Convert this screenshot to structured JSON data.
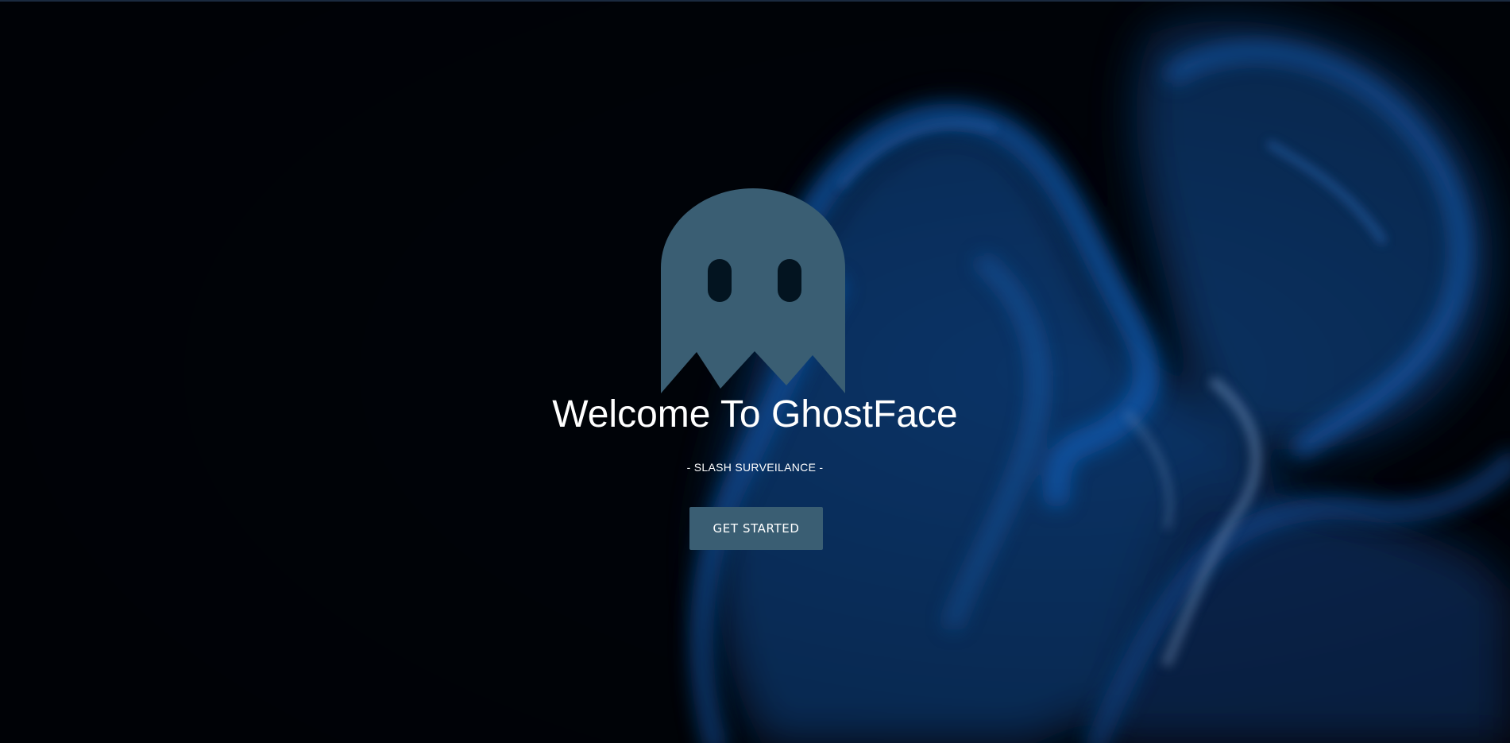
{
  "hero": {
    "logo_icon": "ghost-icon",
    "title": "Welcome To GhostFace",
    "tagline": "- SLASH SURVEILANCE -",
    "cta_label": "GET STARTED"
  },
  "colors": {
    "background": "#00040a",
    "accent": "#3a5e73",
    "smoke": "#0a4f9c",
    "text": "#ffffff"
  }
}
